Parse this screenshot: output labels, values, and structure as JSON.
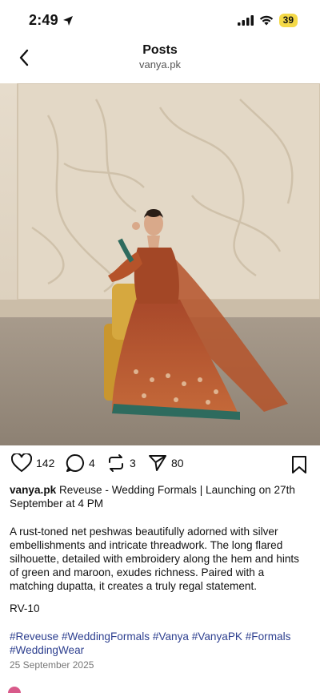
{
  "status_bar": {
    "time": "2:49",
    "battery": "39"
  },
  "header": {
    "title": "Posts",
    "subtitle": "vanya.pk"
  },
  "actions": {
    "likes": "142",
    "comments": "4",
    "reposts": "3",
    "shares": "80"
  },
  "caption": {
    "username": "vanya.pk",
    "text": "Reveuse - Wedding Formals | Launching on 27th September at 4 PM"
  },
  "description": "A rust-toned net peshwas beautifully adorned with silver embellishments and intricate threadwork. The long flared silhouette, detailed with embroidery along the hem and hints of green and maroon, exudes richness. Paired with a matching dupatta, it creates a truly regal statement.",
  "code": "RV-10",
  "hashtags": [
    "#Reveuse",
    "#WeddingFormals",
    "#Vanya",
    "#VanyaPK",
    "#Formals",
    "#WeddingWear"
  ],
  "date": "25 September 2025",
  "colors": {
    "hashtag": "#2d3f8f",
    "battery": "#f4d948",
    "dress": "#b5532a"
  }
}
